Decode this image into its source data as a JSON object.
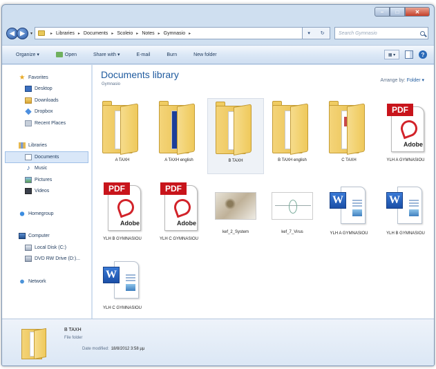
{
  "window": {
    "controls": {
      "minimize": "–",
      "maximize": "□",
      "close": "✕"
    }
  },
  "address": {
    "crumbs": [
      "Libraries",
      "Documents",
      "Scoleio",
      "Notes",
      "Gymnasio"
    ],
    "search_placeholder": "Search Gymnasio",
    "refresh_glyph": "↻"
  },
  "toolbar": {
    "organize": "Organize ▾",
    "open": "Open",
    "share_with": "Share with ▾",
    "email": "E-mail",
    "burn": "Burn",
    "new_folder": "New folder"
  },
  "nav": {
    "favorites": "Favorites",
    "desktop": "Desktop",
    "downloads": "Downloads",
    "dropbox": "Dropbox",
    "recent": "Recent Places",
    "libraries": "Libraries",
    "documents": "Documents",
    "music": "Music",
    "pictures": "Pictures",
    "videos": "Videos",
    "homegroup": "Homegroup",
    "computer": "Computer",
    "local_disk": "Local Disk (C:)",
    "dvd": "DVD RW Drive (D:)...",
    "network": "Network"
  },
  "content": {
    "title": "Documents library",
    "subtitle": "Gymnasio",
    "arrange_label": "Arrange by:",
    "arrange_value": "Folder ▾"
  },
  "files": [
    {
      "label": "A TAXH",
      "kind": "folder"
    },
    {
      "label": "A TAXH english",
      "kind": "folder"
    },
    {
      "label": "B TAXH",
      "kind": "folder"
    },
    {
      "label": "B TAXH english",
      "kind": "folder"
    },
    {
      "label": "C TAXH",
      "kind": "folder"
    },
    {
      "label": "YLH A GYMNASIOU",
      "kind": "pdf"
    },
    {
      "label": "YLH B GYMNASIOU",
      "kind": "pdf"
    },
    {
      "label": "YLH C GYMNASIOU",
      "kind": "pdf"
    },
    {
      "label": "kef_2_System",
      "kind": "image"
    },
    {
      "label": "kef_7_Virus",
      "kind": "image"
    },
    {
      "label": "YLH A GYMNASIOU",
      "kind": "word"
    },
    {
      "label": "YLH B GYMNASIOU",
      "kind": "word"
    },
    {
      "label": "YLH C GYMNASIOU",
      "kind": "word"
    }
  ],
  "badges": {
    "pdf": "PDF",
    "adobe": "Adobe",
    "word": "W"
  },
  "details": {
    "name": "B TAXH",
    "type": "File folder",
    "modified_label": "Date modified:",
    "modified_value": "18/8/2012 3:58 μμ"
  }
}
